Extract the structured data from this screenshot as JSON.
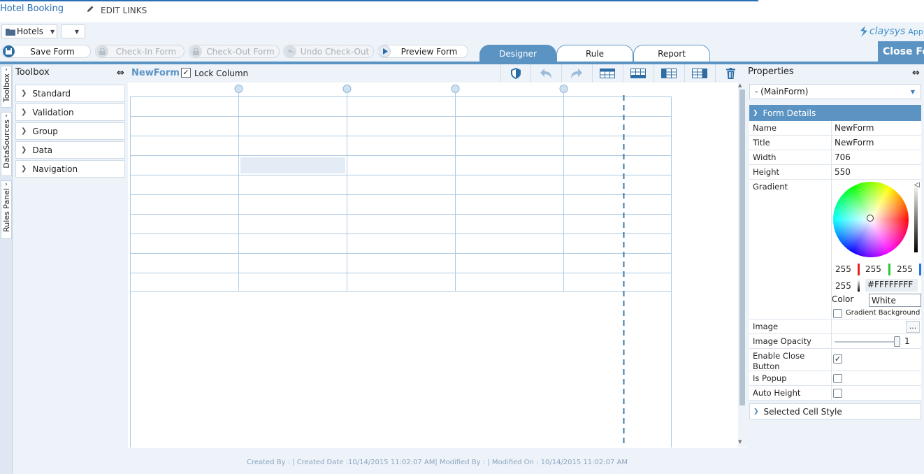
{
  "app": {
    "title": "Hotel Booking",
    "edit_links": "EDIT LINKS",
    "brand": "claysys",
    "brand_suffix": "AppFor"
  },
  "selector": {
    "folder": "Hotels",
    "second": ""
  },
  "ribbon": {
    "save": "Save Form",
    "checkin": "Check-In Form",
    "checkout": "Check-Out Form",
    "undo_checkout": "Undo Check-Out",
    "preview": "Preview Form",
    "close": "Close For"
  },
  "tabs": [
    "Designer",
    "Rule",
    "Report"
  ],
  "side_tabs": [
    "Toolbox",
    "DataSources",
    "Rules Panel"
  ],
  "toolbox": {
    "title": "Toolbox",
    "items": [
      "Standard",
      "Validation",
      "Group",
      "Data",
      "Navigation"
    ]
  },
  "canvas": {
    "form_name": "NewForm",
    "lock_label": "Lock Column",
    "lock_checked": true,
    "rows": 10,
    "cols": 5
  },
  "footer": {
    "text": "Created By :  |  Created Date :10/14/2015 11:02:07 AM|  Modified By : |  Modified On : 10/14/2015 11:02:07 AM"
  },
  "properties": {
    "title": "Properties",
    "selector": "- (MainForm)",
    "section": "Form Details",
    "name_label": "Name",
    "name": "NewForm",
    "title_label": "Title",
    "title_value": "NewForm",
    "width_label": "Width",
    "width": "706",
    "height_label": "Height",
    "height": "550",
    "gradient_label": "Gradient",
    "rgb": {
      "r": "255",
      "g": "255",
      "b": "255",
      "a": "255"
    },
    "hex": "#FFFFFFFF",
    "color_label": "Color",
    "color_name": "White",
    "gradient_bg": "Gradient Background",
    "image_label": "Image",
    "image_btn": "...",
    "opacity_label": "Image Opacity",
    "opacity": "1",
    "enable_close_label": "Enable Close Button",
    "enable_close": true,
    "popup_label": "Is Popup",
    "is_popup": false,
    "autoheight_label": "Auto Height",
    "auto_height": false,
    "selected_cell_style": "Selected Cell Style"
  },
  "colors": {
    "accent": "#5b93c3",
    "link": "#2a6fb5",
    "grid": "#aecbe3"
  }
}
